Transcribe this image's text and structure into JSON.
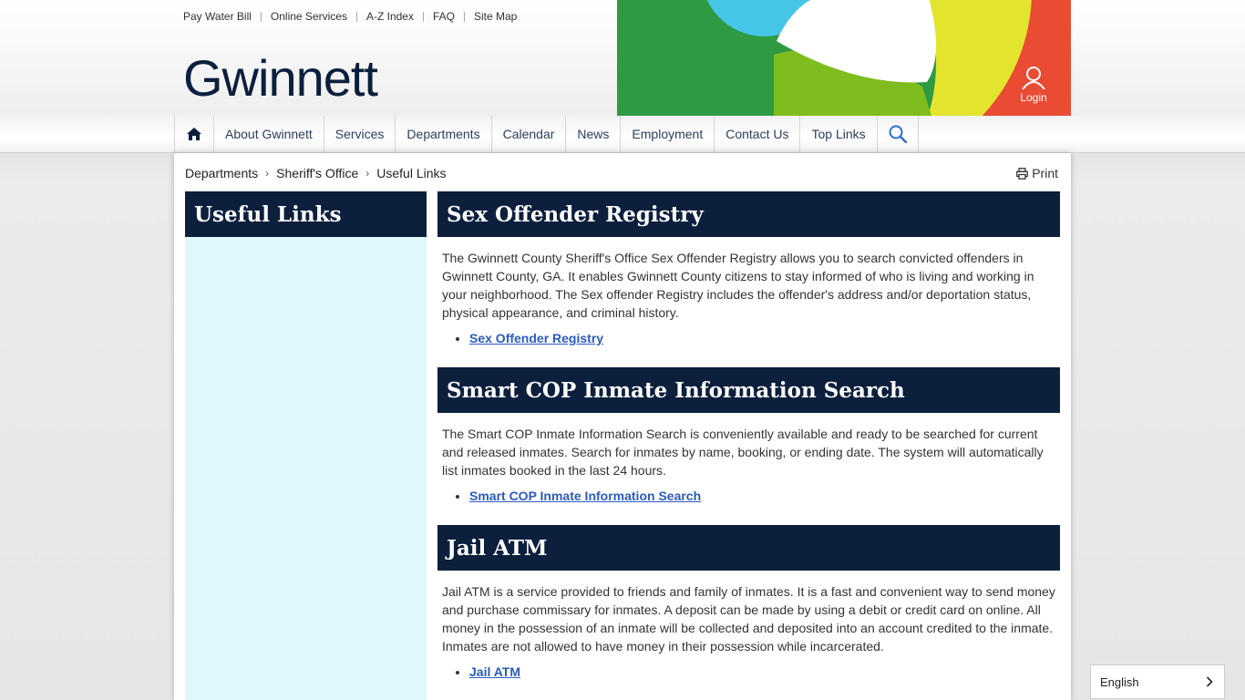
{
  "utility_links": [
    "Pay Water Bill",
    "Online Services",
    "A-Z Index",
    "FAQ",
    "Site Map"
  ],
  "logo_text": "Gwinnett",
  "login_label": "Login",
  "nav": {
    "items": [
      "About Gwinnett",
      "Services",
      "Departments",
      "Calendar",
      "News",
      "Employment",
      "Contact Us",
      "Top Links"
    ]
  },
  "breadcrumb": [
    "Departments",
    "Sheriff's Office",
    "Useful Links"
  ],
  "print_label": "Print",
  "sidebar": {
    "title": "Useful Links"
  },
  "sections": [
    {
      "title": "Sex Offender Registry",
      "body": "The Gwinnett County Sheriff's Office Sex Offender Registry allows you to search convicted offenders in Gwinnett County, GA. It enables Gwinnett County citizens to stay informed of who is living and working in your neighborhood. The Sex offender Registry includes the offender's address and/or deportation status, physical appearance, and criminal history.",
      "link": "Sex Offender Registry"
    },
    {
      "title": "Smart COP Inmate Information Search",
      "body": "The Smart COP Inmate Information Search is conveniently available and ready to be searched for current and released inmates. Search for inmates by name, booking, or ending date. The system will automatically list inmates booked in the last 24 hours.",
      "link": "Smart COP Inmate Information Search"
    },
    {
      "title": "Jail ATM",
      "body": "Jail ATM is a service provided to friends and family of inmates. It is a fast and convenient way to send money and purchase commissary for inmates. A deposit can be made by using a debit or credit card on online. All money in the possession of an inmate will be collected and deposited into an account credited to the inmate. Inmates are not allowed to have money in their possession while incarcerated.",
      "link": "Jail ATM"
    }
  ],
  "language": {
    "selected": "English"
  },
  "colors": {
    "navy": "#0c1f3d",
    "link": "#2a5bbf",
    "sidebar_bg": "#e0f7fb",
    "art_red": "#e94b33",
    "art_green": "#2e9a44",
    "art_lime": "#7fbd1e",
    "art_yellow": "#e3e42e",
    "art_cyan": "#45c6e8"
  },
  "icons": [
    "home-icon",
    "search-icon",
    "user-icon",
    "printer-icon",
    "chevron-right-icon"
  ]
}
